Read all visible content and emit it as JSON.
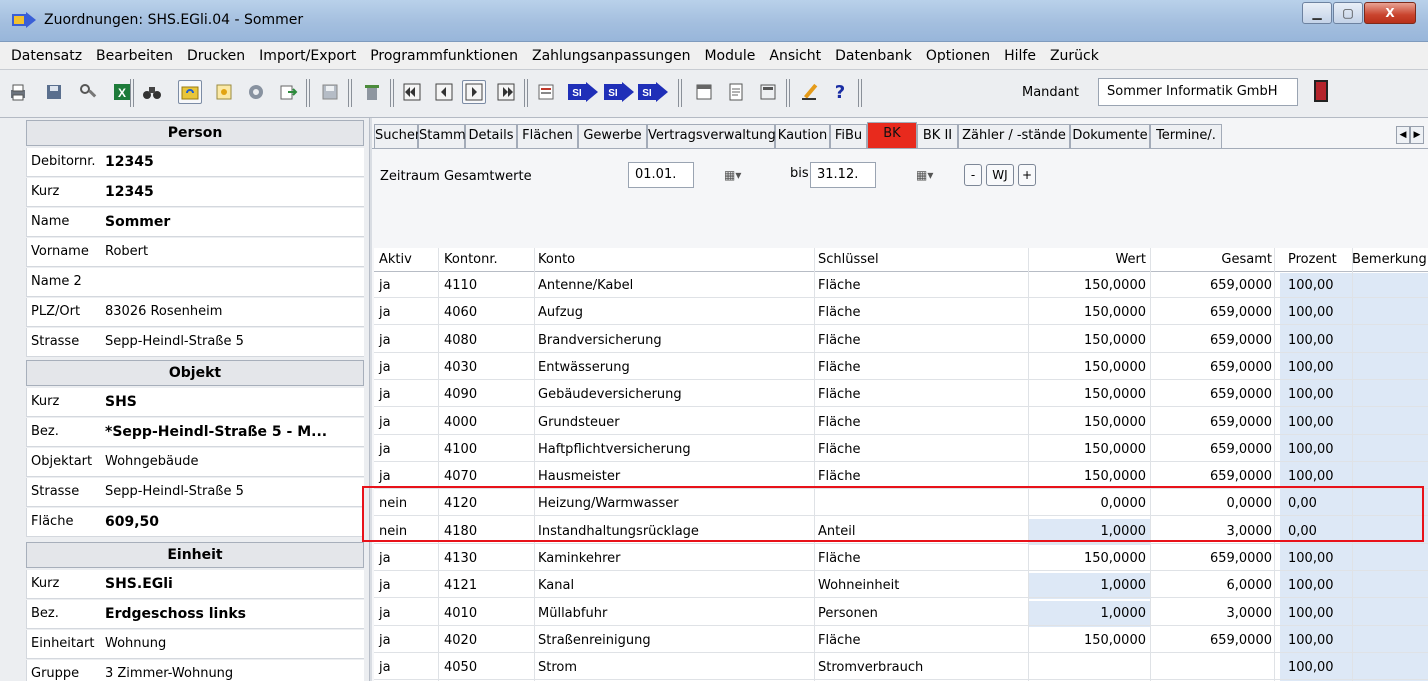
{
  "window": {
    "title": "Zuordnungen: SHS.EGli.04 - Sommer",
    "min": "▁",
    "max": "▢",
    "close": "X"
  },
  "menu": [
    "Datensatz",
    "Bearbeiten",
    "Drucken",
    "Import/Export",
    "Programmfunktionen",
    "Zahlungsanpassungen",
    "Module",
    "Ansicht",
    "Datenbank",
    "Optionen",
    "Hilfe",
    "Zurück"
  ],
  "toolbar": {
    "mandant_label": "Mandant",
    "mandant_value": "Sommer Informatik GmbH",
    "icons": [
      "print-icon",
      "save-disk-icon",
      "tools-icon",
      "excel-icon",
      "binoculars-icon",
      "folder-refresh-icon",
      "sun-icon",
      "gear-icon",
      "export-icon",
      "floppy-icon",
      "trash-icon",
      "first-record-icon",
      "prev-record-icon",
      "next-record-icon",
      "last-record-icon",
      "form-icon",
      "sl-icon",
      "sl-icon-2",
      "sl-icon-3",
      "calendar-icon",
      "document-icon",
      "calculator-icon",
      "pen-icon",
      "help-icon",
      "exit-icon"
    ],
    "glyphs": {
      "sl": "SI",
      "help": "?"
    }
  },
  "person": {
    "header": "Person",
    "fields": [
      {
        "label": "Debitornr.",
        "value": "12345"
      },
      {
        "label": "Kurz",
        "value": "12345"
      },
      {
        "label": "Name",
        "value": "Sommer"
      },
      {
        "label": "Vorname",
        "value": "Robert"
      },
      {
        "label": "Name 2",
        "value": ""
      },
      {
        "label": "PLZ/Ort",
        "value": "83026 Rosenheim"
      },
      {
        "label": "Strasse",
        "value": "Sepp-Heindl-Straße 5"
      }
    ]
  },
  "objekt": {
    "header": "Objekt",
    "fields": [
      {
        "label": "Kurz",
        "value": "SHS"
      },
      {
        "label": "Bez.",
        "value": "*Sepp-Heindl-Straße 5 - M..."
      },
      {
        "label": "Objektart",
        "value": "Wohngebäude"
      },
      {
        "label": "Strasse",
        "value": "Sepp-Heindl-Straße 5"
      },
      {
        "label": "Fläche",
        "value": "609,50"
      }
    ]
  },
  "einheit": {
    "header": "Einheit",
    "fields": [
      {
        "label": "Kurz",
        "value": "SHS.EGli"
      },
      {
        "label": "Bez.",
        "value": "Erdgeschoss links"
      },
      {
        "label": "Einheitart",
        "value": "Wohnung"
      },
      {
        "label": "Gruppe",
        "value": "3 Zimmer-Wohnung"
      }
    ]
  },
  "tabs": [
    "Suchen",
    "Stamm",
    "Details",
    "Flächen",
    "Gewerbe",
    "Vertragsverwaltung",
    "Kaution",
    "FiBu",
    "BK",
    "BK II",
    "Zähler / -stände",
    "Dokumente",
    "Termine/."
  ],
  "active_tab": "BK",
  "zeitraum": {
    "label": "Zeitraum Gesamtwerte",
    "from": "01.01.",
    "bis": "bis",
    "to": "31.12.",
    "btn_minus": "-",
    "btn_wj": "WJ",
    "btn_plus": "+"
  },
  "grid": {
    "columns": [
      "Aktiv",
      "Kontonr.",
      "Konto",
      "Schlüssel",
      "Wert",
      "Gesamt",
      "Prozent",
      "Bemerkung"
    ],
    "rows": [
      {
        "aktiv": "ja",
        "nr": "4110",
        "konto": "Antenne/Kabel",
        "schluessel": "Fläche",
        "wert": "150,0000",
        "gesamt": "659,0000",
        "prozent": "100,00"
      },
      {
        "aktiv": "ja",
        "nr": "4060",
        "konto": "Aufzug",
        "schluessel": "Fläche",
        "wert": "150,0000",
        "gesamt": "659,0000",
        "prozent": "100,00"
      },
      {
        "aktiv": "ja",
        "nr": "4080",
        "konto": "Brandversicherung",
        "schluessel": "Fläche",
        "wert": "150,0000",
        "gesamt": "659,0000",
        "prozent": "100,00"
      },
      {
        "aktiv": "ja",
        "nr": "4030",
        "konto": "Entwässerung",
        "schluessel": "Fläche",
        "wert": "150,0000",
        "gesamt": "659,0000",
        "prozent": "100,00"
      },
      {
        "aktiv": "ja",
        "nr": "4090",
        "konto": "Gebäudeversicherung",
        "schluessel": "Fläche",
        "wert": "150,0000",
        "gesamt": "659,0000",
        "prozent": "100,00"
      },
      {
        "aktiv": "ja",
        "nr": "4000",
        "konto": "Grundsteuer",
        "schluessel": "Fläche",
        "wert": "150,0000",
        "gesamt": "659,0000",
        "prozent": "100,00"
      },
      {
        "aktiv": "ja",
        "nr": "4100",
        "konto": "Haftpflichtversicherung",
        "schluessel": "Fläche",
        "wert": "150,0000",
        "gesamt": "659,0000",
        "prozent": "100,00"
      },
      {
        "aktiv": "ja",
        "nr": "4070",
        "konto": "Hausmeister",
        "schluessel": "Fläche",
        "wert": "150,0000",
        "gesamt": "659,0000",
        "prozent": "100,00"
      },
      {
        "aktiv": "nein",
        "nr": "4120",
        "konto": "Heizung/Warmwasser",
        "schluessel": "",
        "wert": "0,0000",
        "gesamt": "0,0000",
        "prozent": "0,00"
      },
      {
        "aktiv": "nein",
        "nr": "4180",
        "konto": "Instandhaltungsrücklage",
        "schluessel": "Anteil",
        "wert": "1,0000",
        "gesamt": "3,0000",
        "prozent": "0,00"
      },
      {
        "aktiv": "ja",
        "nr": "4130",
        "konto": "Kaminkehrer",
        "schluessel": "Fläche",
        "wert": "150,0000",
        "gesamt": "659,0000",
        "prozent": "100,00"
      },
      {
        "aktiv": "ja",
        "nr": "4121",
        "konto": "Kanal",
        "schluessel": "Wohneinheit",
        "wert": "1,0000",
        "gesamt": "6,0000",
        "prozent": "100,00"
      },
      {
        "aktiv": "ja",
        "nr": "4010",
        "konto": "Müllabfuhr",
        "schluessel": "Personen",
        "wert": "1,0000",
        "gesamt": "3,0000",
        "prozent": "100,00"
      },
      {
        "aktiv": "ja",
        "nr": "4020",
        "konto": "Straßenreinigung",
        "schluessel": "Fläche",
        "wert": "150,0000",
        "gesamt": "659,0000",
        "prozent": "100,00"
      },
      {
        "aktiv": "ja",
        "nr": "4050",
        "konto": "Strom",
        "schluessel": "Stromverbrauch",
        "wert": "",
        "gesamt": "",
        "prozent": "100,00"
      }
    ]
  },
  "colors": {
    "active_tab": "#e82a1d",
    "highlight_border": "#e8121a",
    "cell_blue": "#dde8f6"
  }
}
